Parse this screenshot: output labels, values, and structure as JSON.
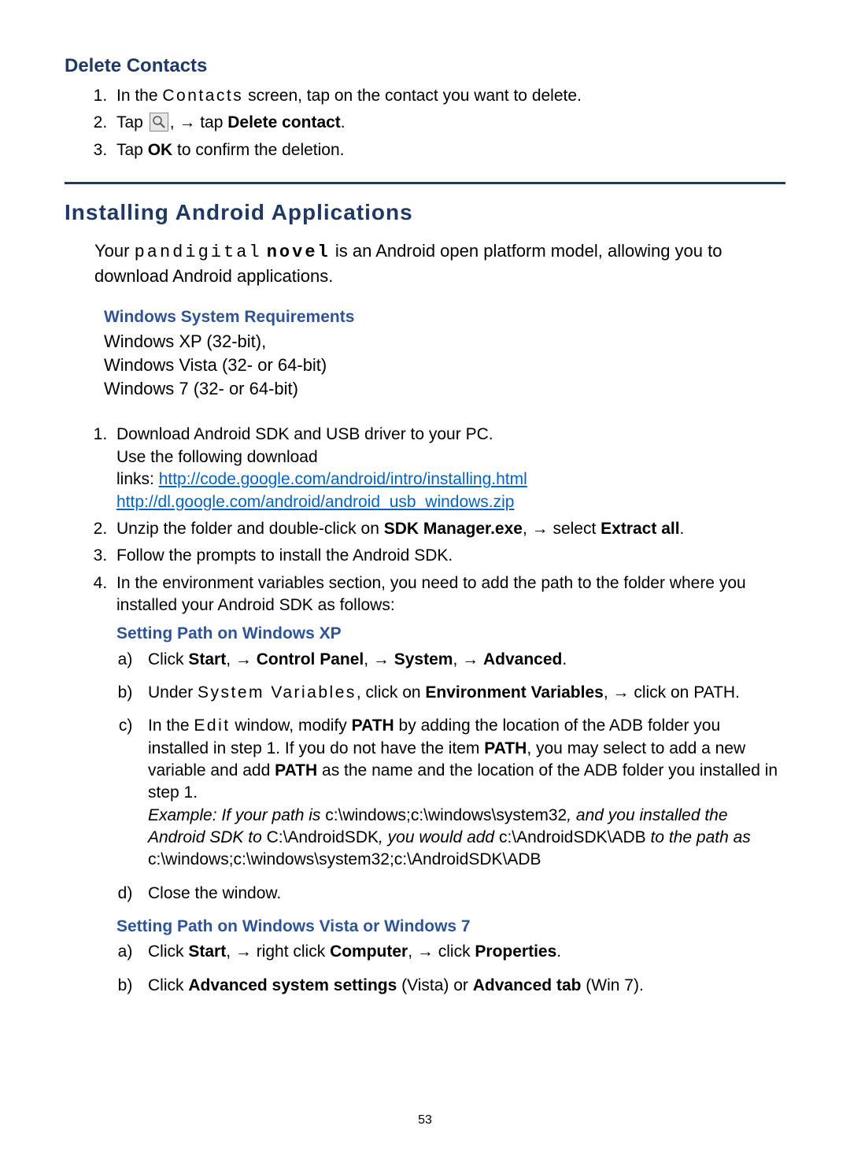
{
  "page_number": "53",
  "section1": {
    "heading": "Delete Contacts",
    "steps": {
      "s1_a": "In the ",
      "s1_b": "Contacts",
      "s1_c": " screen, tap on the contact you want to delete.",
      "s2_a": "Tap ",
      "s2_b": ", ",
      "s2_arrow": "→",
      "s2_c": " tap ",
      "s2_d": "Delete contact",
      "s2_e": ".",
      "s3_a": "Tap ",
      "s3_b": "OK",
      "s3_c": " to confirm the deletion."
    }
  },
  "section2": {
    "heading": "Installing Android Applications",
    "intro_a": "Your ",
    "intro_b": "pandigital",
    "intro_c": "novel",
    "intro_d": " is an Android open platform model, allowing you to download Android applications.",
    "req_heading": "Windows System Requirements",
    "req_l1": "Windows XP (32-bit),",
    "req_l2": "Windows Vista (32- or 64-bit)",
    "req_l3": "Windows 7 (32- or 64-bit)",
    "steps": {
      "s1_l1": "Download Android SDK and USB driver to your PC.",
      "s1_l2": "Use the following download",
      "s1_l3a": "links: ",
      "s1_link1": "http://code.google.com/android/intro/installing.html",
      "s1_link2": "http://dl.google.com/android/android_usb_windows.zip",
      "s2_a": "Unzip the folder and double-click on ",
      "s2_b": "SDK Manager.exe",
      "s2_c": ", ",
      "s2_arrow": "→",
      "s2_d": " select ",
      "s2_e": "Extract all",
      "s2_f": ".",
      "s3": "Follow the prompts to install the Android SDK.",
      "s4": "In the environment variables section, you need to add the path to the folder where you installed your Android SDK as follows:"
    },
    "xp": {
      "heading": "Setting Path on Windows XP",
      "a_1": "Click ",
      "a_2": "Start",
      "a_3": ", ",
      "a_arrow": "→",
      "a_4": " ",
      "a_5": "Control Panel",
      "a_6": ", ",
      "a_7": " ",
      "a_8": "System",
      "a_9": ", ",
      "a_10": " ",
      "a_11": "Advanced",
      "a_12": ".",
      "b_1": "Under ",
      "b_2": "System Variables",
      "b_3": ", click on ",
      "b_4": "Environment Variables",
      "b_5": ", ",
      "b_arrow": "→",
      "b_6": " click on PATH.",
      "c_1": "In the ",
      "c_2": "Edit",
      "c_3": " window, modify ",
      "c_4": "PATH",
      "c_5": " by adding the location of the ADB folder you installed in step 1. If you do not have the item ",
      "c_6": "PATH",
      "c_7": ", you may select to add a new variable and add ",
      "c_8": "PATH",
      "c_9": " as the name and the location of the ADB folder you installed in step 1.",
      "ex_1": "Example: If your path is ",
      "ex_2": "c:\\windows;c:\\windows\\system32",
      "ex_3": ", and you installed the Android SDK to ",
      "ex_4": "C:\\AndroidSDK",
      "ex_5": ", you would add ",
      "ex_6": "c:\\AndroidSDK\\ADB",
      "ex_7": " to the path as ",
      "ex_8": "c:\\windows;c:\\windows\\system32;c:\\AndroidSDK\\ADB",
      "d": "Close the window."
    },
    "vista": {
      "heading": "Setting Path on Windows Vista or Windows 7",
      "a_1": "Click ",
      "a_2": "Start",
      "a_3": ", ",
      "a_arrow": "→",
      "a_4": " right click ",
      "a_5": "Computer",
      "a_6": ", ",
      "a_7": " click ",
      "a_8": "Properties",
      "a_9": ".",
      "b_1": "Click ",
      "b_2": "Advanced system settings",
      "b_3": " (Vista) or ",
      "b_4": "Advanced tab",
      "b_5": " (Win 7)."
    }
  }
}
